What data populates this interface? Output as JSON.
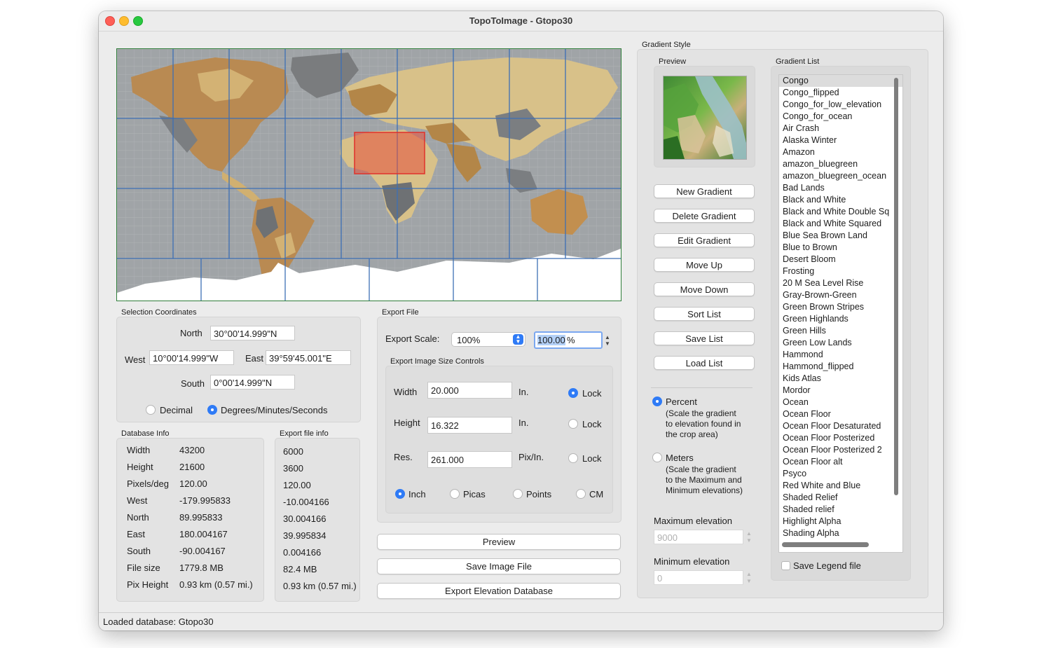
{
  "window": {
    "title": "TopoToImage - Gtopo30",
    "status": "Loaded database: Gtopo30",
    "traffic_lights": [
      "#fe5f57",
      "#febc2e",
      "#28c840"
    ]
  },
  "selection": {
    "label": "Selection Coordinates",
    "north_label": "North",
    "north": "30°00'14.999\"N",
    "west_label": "West",
    "west": "10°00'14.999\"W",
    "east_label": "East",
    "east": "39°59'45.001\"E",
    "south_label": "South",
    "south": "0°00'14.999\"N",
    "decimal_label": "Decimal",
    "dms_label": "Degrees/Minutes/Seconds"
  },
  "database_info": {
    "label": "Database Info",
    "rows": [
      {
        "k": "Width",
        "v": "43200"
      },
      {
        "k": "Height",
        "v": "21600"
      },
      {
        "k": "Pixels/deg",
        "v": "120.00"
      },
      {
        "k": "West",
        "v": "-179.995833"
      },
      {
        "k": "North",
        "v": "89.995833"
      },
      {
        "k": "East",
        "v": "180.004167"
      },
      {
        "k": "South",
        "v": "-90.004167"
      },
      {
        "k": "File size",
        "v": "1779.8 MB"
      },
      {
        "k": "Pix Height",
        "v": "0.93 km (0.57 mi.)"
      }
    ]
  },
  "export_info": {
    "label": "Export file info",
    "values": [
      "6000",
      "3600",
      "120.00",
      "-10.004166",
      "30.004166",
      "39.995834",
      "0.004166",
      "82.4 MB",
      "0.93 km (0.57 mi.)"
    ]
  },
  "export_file": {
    "label": "Export File",
    "scale_label": "Export Scale:",
    "scale_select": "100%",
    "scale_value_sel": "100.00",
    "scale_value_rest": "%",
    "size_controls_label": "Export Image Size Controls",
    "width_label": "Width",
    "width": "20.000",
    "width_unit": "In.",
    "height_label": "Height",
    "height": "16.322",
    "height_unit": "In.",
    "res_label": "Res.",
    "res": "261.000",
    "res_unit": "Pix/In.",
    "lock_label": "Lock",
    "units": [
      "Inch",
      "Picas",
      "Points",
      "CM"
    ],
    "preview_btn": "Preview",
    "save_btn": "Save Image File",
    "export_db_btn": "Export Elevation Database"
  },
  "gradient_style": {
    "label": "Gradient Style",
    "preview_label": "Preview",
    "buttons": [
      "New Gradient",
      "Delete Gradient",
      "Edit Gradient",
      "Move Up",
      "Move Down",
      "Sort List",
      "Save List",
      "Load List"
    ],
    "percent_label": "Percent",
    "percent_desc": [
      "(Scale the gradient",
      "to elevation found in",
      "the crop area)"
    ],
    "meters_label": "Meters",
    "meters_desc": [
      "(Scale the gradient",
      "to the Maximum and",
      "Minimum elevations)"
    ],
    "max_label": "Maximum elevation",
    "max_value": "9000",
    "min_label": "Minimum elevation",
    "min_value": "0"
  },
  "gradient_list": {
    "label": "Gradient List",
    "items": [
      "Congo",
      "Congo_flipped",
      "Congo_for_low_elevation",
      "Congo_for_ocean",
      "Air Crash",
      "Alaska Winter",
      "Amazon",
      "amazon_bluegreen",
      "amazon_bluegreen_ocean",
      "Bad Lands",
      "Black and White",
      "Black and White Double Sq",
      "Black and White Squared",
      "Blue Sea Brown Land",
      "Blue to Brown",
      "Desert Bloom",
      "Frosting",
      "20 M Sea Level Rise",
      "Gray-Brown-Green",
      "Green Brown Stripes",
      "Green Highlands",
      "Green Hills",
      "Green Low Lands",
      "Hammond",
      "Hammond_flipped",
      "Kids Atlas",
      "Mordor",
      "Ocean",
      "Ocean Floor",
      "Ocean Floor Desaturated",
      "Ocean Floor Posterized",
      "Ocean Floor Posterized 2",
      "Ocean Floor alt",
      "Psyco",
      "Red White and Blue",
      "Shaded Relief",
      "Shaded relief",
      "Highlight Alpha",
      "Shading Alpha"
    ],
    "selected": "Congo",
    "save_legend_label": "Save Legend file"
  }
}
